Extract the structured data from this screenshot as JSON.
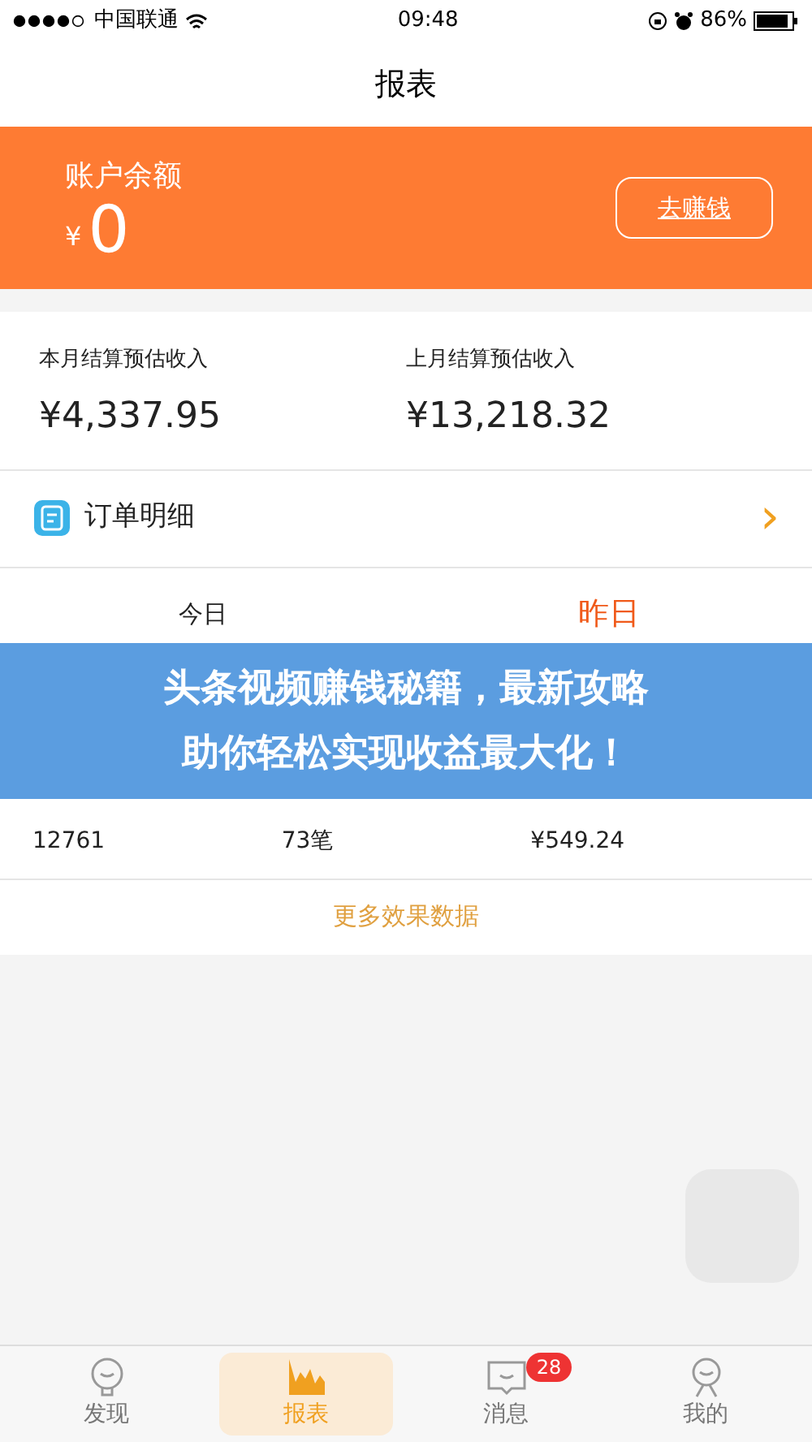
{
  "status_bar": {
    "carrier": "中国联通",
    "time": "09:48",
    "battery": "86%"
  },
  "title": "报表",
  "balance": {
    "label": "账户余额",
    "currency": "¥",
    "amount": "0",
    "button": "去赚钱"
  },
  "stats": [
    {
      "label": "本月结算预估收入",
      "value": "¥4,337.95"
    },
    {
      "label": "上月结算预估收入",
      "value": "¥13,218.32"
    }
  ],
  "order_link": {
    "label": "订单明细",
    "chevron": "›"
  },
  "day_tabs": [
    {
      "label": "今日",
      "selected": false
    },
    {
      "label": "昨日",
      "selected": true
    }
  ],
  "metrics": [
    {
      "value": "12761"
    },
    {
      "value": "73笔"
    },
    {
      "value": "¥549.24"
    }
  ],
  "more_link": "更多效果数据",
  "banner": {
    "lines": [
      "头条视频赚钱秘籍，最新攻略",
      "助你轻松实现收益最大化！"
    ]
  },
  "tab_bar": [
    {
      "kind": "bulb",
      "label": "发现",
      "selected": false
    },
    {
      "kind": "chart",
      "label": "报表",
      "selected": true
    },
    {
      "kind": "message",
      "label": "消息",
      "selected": false,
      "badge": "28"
    },
    {
      "kind": "person",
      "label": "我的",
      "selected": false
    }
  ]
}
